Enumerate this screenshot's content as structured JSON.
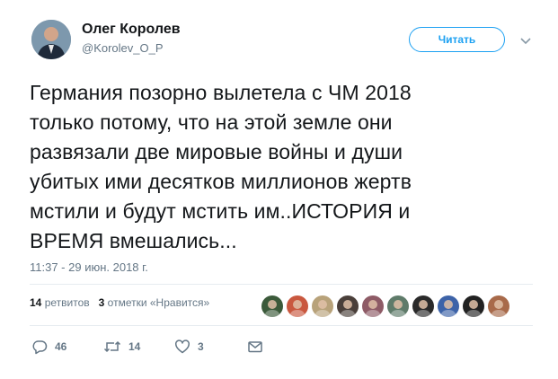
{
  "author": {
    "name": "Олег Королев",
    "handle": "@Korolev_O_P",
    "avatar": "person-in-suit-avatar"
  },
  "follow_button": {
    "label": "Читать",
    "color": "#1da1f2"
  },
  "menu": {
    "icon": "chevron-down-icon"
  },
  "tweet": {
    "text": "Германия позорно вылетела с ЧМ 2018\nтолько потому, что на этой земле они\nразвязали две мировые войны и души\nубитых ими десятков миллионов жертв\nмстили и будут мстить им..ИСТОРИЯ и\nВРЕМЯ вмешались...",
    "timestamp": "11:37 - 29 июн. 2018 г."
  },
  "stats": {
    "retweets_count": "14",
    "retweets_label": "ретвитов",
    "likes_count": "3",
    "likes_label": "отметки «Нравится»"
  },
  "liker_avatars": [
    {
      "icon": "liker-avatar-1",
      "color": "#3b5a3a"
    },
    {
      "icon": "liker-avatar-2",
      "color": "#c9583f"
    },
    {
      "icon": "liker-avatar-3",
      "color": "#b8a27a"
    },
    {
      "icon": "liker-avatar-4",
      "color": "#4a3f3a"
    },
    {
      "icon": "liker-avatar-5",
      "color": "#8e5b66"
    },
    {
      "icon": "liker-avatar-6",
      "color": "#5f7b6a"
    },
    {
      "icon": "liker-avatar-7",
      "color": "#2a2a2a"
    },
    {
      "icon": "liker-avatar-8",
      "color": "#3d63a8"
    },
    {
      "icon": "liker-avatar-9",
      "color": "#222222"
    },
    {
      "icon": "liker-avatar-10",
      "color": "#a86a4a"
    }
  ],
  "actions": {
    "reply_count": "46",
    "retweet_count": "14",
    "like_count": "3"
  }
}
